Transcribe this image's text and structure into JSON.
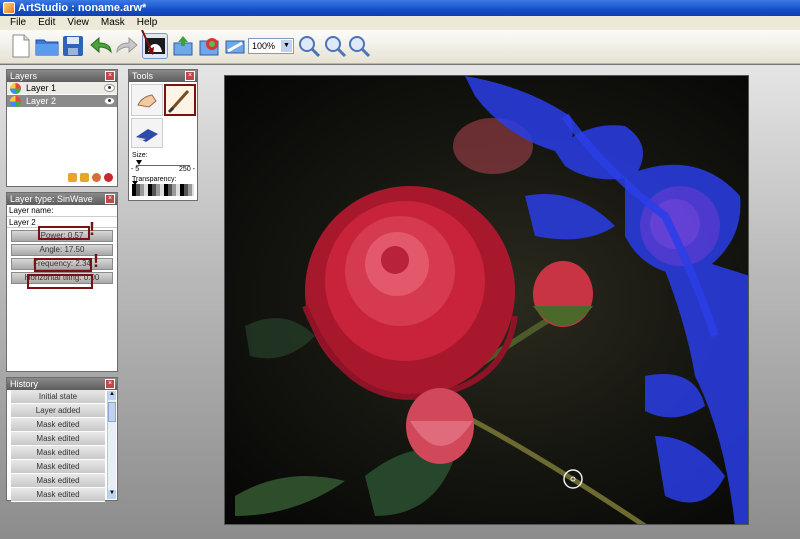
{
  "window": {
    "title": "ArtStudio : noname.arw*"
  },
  "menu": {
    "items": [
      "File",
      "Edit",
      "View",
      "Mask",
      "Help"
    ]
  },
  "toolbar": {
    "zoom": "100%"
  },
  "layers_panel": {
    "title": "Layers",
    "layers": [
      {
        "name": "Layer 1",
        "selected": false
      },
      {
        "name": "Layer 2",
        "selected": true
      }
    ]
  },
  "tools_panel": {
    "title": "Tools",
    "size_label": "Size:",
    "size_min": "- 5",
    "size_max": "250 -",
    "transparency_label": "Transparency:"
  },
  "layer_type_panel": {
    "title": "Layer type: SinWave",
    "layer_name_label": "Layer name:",
    "layer_name_value": "Layer 2",
    "props": [
      {
        "label": "Power: 0.57"
      },
      {
        "label": "Angle: 17.50"
      },
      {
        "label": "Frequency: 2.34"
      },
      {
        "label": "Horizontal tiling: 0.00"
      }
    ]
  },
  "history_panel": {
    "title": "History",
    "items": [
      "Initial state",
      "Layer added",
      "Mask edited",
      "Mask edited",
      "Mask edited",
      "Mask edited",
      "Mask edited",
      "Mask edited"
    ]
  },
  "colors": {
    "mask_blue": "#2a3ee8",
    "rose_red": "#c8233a",
    "highlight": "#7b1010"
  }
}
